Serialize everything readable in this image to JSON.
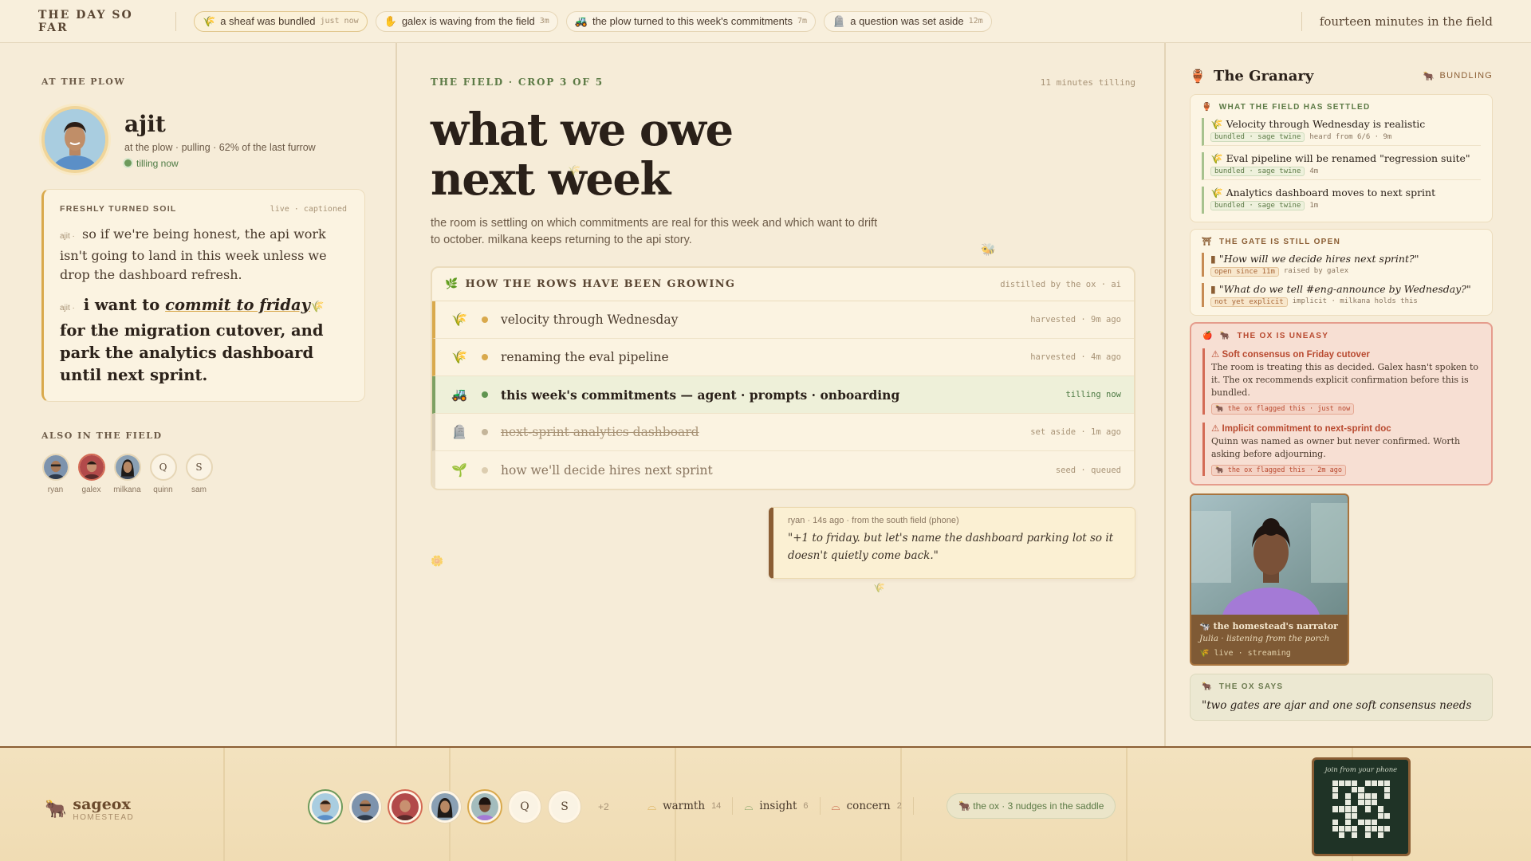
{
  "topbar": {
    "brand": "THE DAY SO FAR",
    "events": [
      {
        "icon": "wheat-icon",
        "glyph": "🌾",
        "text": "a sheaf was bundled",
        "time": "just now",
        "active": true
      },
      {
        "icon": "wave-hand-icon",
        "glyph": "✋",
        "text": "galex is waving from the field",
        "time": "3m"
      },
      {
        "icon": "tractor-icon",
        "glyph": "🚜",
        "text": "the plow turned to this week's commitments",
        "time": "7m"
      },
      {
        "icon": "tombstone-icon",
        "glyph": "🪦",
        "text": "a question was set aside",
        "time": "12m"
      }
    ],
    "elapsed": "fourteen minutes in the field"
  },
  "left": {
    "eyebrow": "AT THE PLOW",
    "speaker": {
      "name": "ajit",
      "sub": "at the plow · pulling · 62% of the last furrow",
      "status": "tilling now"
    },
    "soil": {
      "label": "FRESHLY TURNED SOIL",
      "meta": "live · captioned",
      "line1_who": "ajit ·",
      "line1": "so if we're being honest, the api work isn't going to land in this week unless we drop the dashboard refresh.",
      "line2_who": "ajit ·",
      "line2_pre": "i want to ",
      "line2_em": "commit to friday",
      "line2_post": " for the migration cutover, and park the analytics dashboard until next sprint."
    },
    "also_label": "ALSO IN THE FIELD",
    "people": [
      {
        "name": "ryan",
        "initial": ""
      },
      {
        "name": "galex",
        "initial": ""
      },
      {
        "name": "milkana",
        "initial": ""
      },
      {
        "name": "quinn",
        "initial": "Q"
      },
      {
        "name": "sam",
        "initial": "S"
      }
    ]
  },
  "center": {
    "eyebrow": "THE FIELD · CROP 3 OF 5",
    "meta": "11 minutes tilling",
    "title_l1": "what we owe",
    "title_l2": "next week",
    "lede": "the room is settling on which commitments are real for this week and which want to drift to october. milkana keeps returning to the api story.",
    "rows_title": "HOW THE ROWS HAVE BEEN GROWING",
    "rows_meta": "distilled by the ox · ai",
    "rows": [
      {
        "label": "velocity through Wednesday",
        "status": "harvested · 9m ago",
        "state": "harv",
        "glyph": "🌾",
        "bullet": "#d9a94c"
      },
      {
        "label": "renaming the eval pipeline",
        "status": "harvested · 4m ago",
        "state": "harv",
        "glyph": "🌾",
        "bullet": "#d9a94c"
      },
      {
        "label": "this week's commitments — agent · prompts · onboarding",
        "status": "tilling now",
        "state": "now",
        "glyph": "🚜",
        "bullet": "#5f9450"
      },
      {
        "label": "next-sprint analytics dashboard",
        "status": "set aside · 1m ago",
        "state": "aside",
        "glyph": "🪦",
        "bullet": "#c4b59a"
      },
      {
        "label": "how we'll decide hires next sprint",
        "status": "seed · queued",
        "state": "seed",
        "glyph": "🌱",
        "bullet": "#dccdb0"
      }
    ],
    "quote": {
      "meta": "ryan · 14s ago · from the south field (phone)",
      "text": "\"+1 to friday. but let's name the dashboard parking lot so it doesn't quietly come back.\""
    }
  },
  "granary": {
    "title": "The Granary",
    "badge": "BUNDLING",
    "settled_label": "WHAT THE FIELD HAS SETTLED",
    "settled": [
      {
        "text": "Velocity through Wednesday is realistic",
        "chip": "bundled · sage twine",
        "extra": "heard from 6/6 · 9m"
      },
      {
        "text": "Eval pipeline will be renamed \"regression suite\"",
        "chip": "bundled · sage twine",
        "extra": "4m"
      },
      {
        "text": "Analytics dashboard moves to next sprint",
        "chip": "bundled · sage twine",
        "extra": "1m"
      }
    ],
    "gate_label": "THE GATE IS STILL OPEN",
    "gate": [
      {
        "text": "\"How will we decide hires next sprint?\"",
        "chip": "open since 11m",
        "extra": "raised by galex"
      },
      {
        "text": "\"What do we tell #eng-announce by Wednesday?\"",
        "chip": "not yet explicit",
        "extra": "implicit · milkana holds this"
      }
    ],
    "uneasy_label": "THE OX IS UNEASY",
    "uneasy": [
      {
        "head": "⚠ Soft consensus on Friday cutover",
        "body": "The room is treating this as decided. Galex hasn't spoken to it. The ox recommends explicit confirmation before this is bundled.",
        "chip": "🐂 the ox flagged this · just now"
      },
      {
        "head": "⚠ Implicit commitment to next-sprint doc",
        "body": "Quinn was named as owner but never confirmed. Worth asking before adjourning.",
        "chip": "🐂 the ox flagged this · 2m ago"
      }
    ],
    "narrator": {
      "title": "the homestead's narrator",
      "sub": "Julia · listening from the porch",
      "status": "live · streaming"
    },
    "oxsays_label": "THE OX SAYS",
    "oxsays_quote": "\"two gates are ajar and one soft consensus needs"
  },
  "bottom": {
    "brand": "sageox",
    "brand_sub": "HOMESTEAD",
    "initials": [
      "Q",
      "S"
    ],
    "more": "+2",
    "reactions": [
      {
        "name": "warmth",
        "count": "14",
        "color": "#d9a94c"
      },
      {
        "name": "insight",
        "count": "6",
        "color": "#7ea062"
      },
      {
        "name": "concern",
        "count": "2",
        "color": "#c5563a"
      }
    ],
    "nudge": "🐂 the ox · 3 nudges in the saddle",
    "qr_label": "join from your phone"
  },
  "colors": {
    "accent": "#d9a94c",
    "green": "#5c7a45",
    "brown": "#8b5e34",
    "danger": "#b8492f"
  }
}
